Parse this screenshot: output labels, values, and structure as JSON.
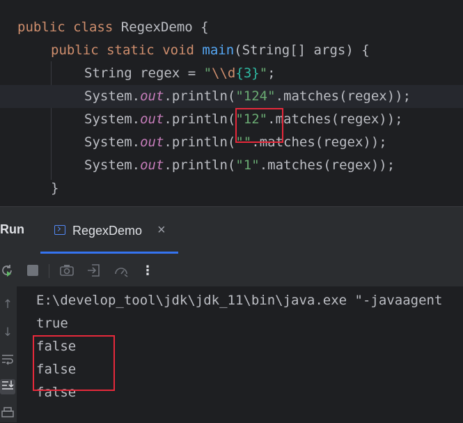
{
  "editor": {
    "line1": {
      "kw1": "public",
      "kw2": "class",
      "name": "RegexDemo",
      "brace": " {"
    },
    "line2": {
      "kw1": "public",
      "kw2": "static",
      "kw3": "void",
      "method": "main",
      "params": "(String[] args) {"
    },
    "line3": {
      "prefix": "String regex = ",
      "q1": "\"",
      "esc": "\\\\d",
      "quant": "{3}",
      "q2": "\"",
      "suffix": ";"
    },
    "print_lines": [
      {
        "cls": "System.",
        "field": "out",
        "call": ".println(",
        "arg": "\"124\"",
        "rest": ".matches(regex));"
      },
      {
        "cls": "System.",
        "field": "out",
        "call": ".println(",
        "arg": "\"12\"",
        "rest": ".matches(regex));"
      },
      {
        "cls": "System.",
        "field": "out",
        "call": ".println(",
        "arg": "\"\"",
        "rest": ".matches(regex));"
      },
      {
        "cls": "System.",
        "field": "out",
        "call": ".println(",
        "arg": "\"1\"",
        "rest": ".matches(regex));"
      }
    ],
    "closing_brace": "}"
  },
  "run_panel": {
    "title": "Run",
    "tab": {
      "label": "RegexDemo",
      "close": "×"
    },
    "toolbar_icons": [
      "rerun-icon",
      "stop-icon",
      "camera-icon",
      "import-icon",
      "profiler-icon",
      "more-icon"
    ],
    "more_label": "⋮",
    "side_icons": [
      "up-arrow-icon",
      "down-arrow-icon",
      "soft-wrap-icon",
      "scroll-to-end-icon",
      "print-icon"
    ]
  },
  "console": {
    "command": "E:\\develop_tool\\jdk\\jdk_11\\bin\\java.exe \"-javaagent",
    "outputs": [
      "true",
      "false",
      "false",
      "false"
    ]
  },
  "colors": {
    "background": "#1e1f22",
    "keyword": "#cf8e6d",
    "method": "#56a8f5",
    "string": "#6aab73",
    "field": "#c77dbb",
    "highlight_box": "#e8293b",
    "tab_accent": "#3574f0"
  }
}
